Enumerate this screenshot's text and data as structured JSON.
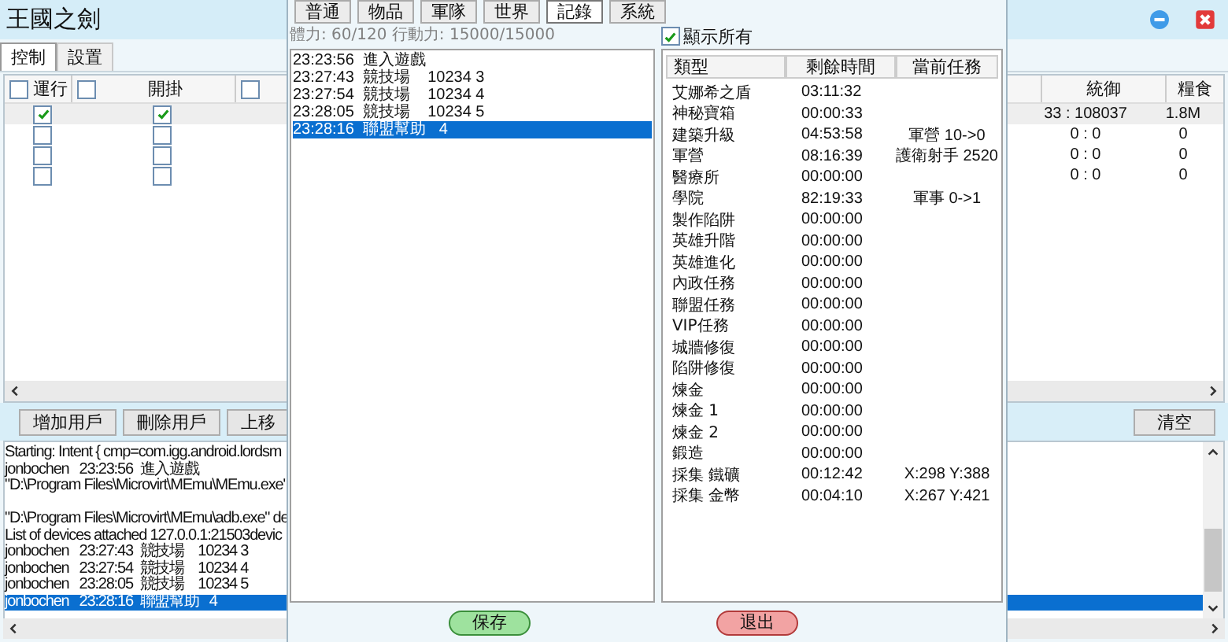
{
  "main_window": {
    "title": "王國之劍",
    "tabs": [
      {
        "label": "控制",
        "selected": true
      },
      {
        "label": "設置",
        "selected": false
      }
    ],
    "accounts_table": {
      "header": {
        "run_checked": false,
        "run_label": "運行",
        "second_checked": false,
        "hack_label": "開掛",
        "third_checked": false,
        "right_columns": [
          "統御",
          "糧食"
        ]
      },
      "rows": [
        {
          "selected": true,
          "run": true,
          "hack": true,
          "leadership": "33 : 108037",
          "food": "1.8M"
        },
        {
          "selected": false,
          "run": false,
          "hack": false,
          "leadership": "0 : 0",
          "food": "0"
        },
        {
          "selected": false,
          "run": false,
          "hack": false,
          "leadership": "0 : 0",
          "food": "0"
        },
        {
          "selected": false,
          "run": false,
          "hack": false,
          "leadership": "0 : 0",
          "food": "0"
        }
      ]
    },
    "buttons": [
      "增加用戶",
      "刪除用戶",
      "上移"
    ],
    "clear_button": "清空",
    "log": [
      {
        "kind": "text",
        "text": "Starting: Intent { cmp=com.igg.android.lordsm",
        "selected": false
      },
      {
        "kind": "text",
        "text": "jonbochen   23:23:56  進入遊戲",
        "selected": false
      },
      {
        "kind": "text",
        "text": "\"D:\\Program Files\\Microvirt\\MEmu\\MEmu.exe\"",
        "selected": false
      },
      {
        "kind": "blank"
      },
      {
        "kind": "text",
        "text": "\"D:\\Program Files\\Microvirt\\MEmu\\adb.exe\" de",
        "selected": false
      },
      {
        "kind": "text",
        "text": "List of devices attached 127.0.0.1:21503devic",
        "selected": false
      },
      {
        "kind": "text",
        "text": "jonbochen   23:27:43  競技場    10234 3",
        "selected": false
      },
      {
        "kind": "text",
        "text": "jonbochen   23:27:54  競技場    10234 4",
        "selected": false
      },
      {
        "kind": "text",
        "text": "jonbochen   23:28:05  競技場    10234 5",
        "selected": false
      },
      {
        "kind": "text",
        "text": "jonbochen   23:28:16  聯盟幫助   4",
        "selected": true
      }
    ]
  },
  "record_dialog": {
    "tabs": [
      {
        "label": "普通",
        "selected": false
      },
      {
        "label": "物品",
        "selected": false
      },
      {
        "label": "軍隊",
        "selected": false
      },
      {
        "label": "世界",
        "selected": false
      },
      {
        "label": "記錄",
        "selected": true
      },
      {
        "label": "系統",
        "selected": false
      }
    ],
    "stats": "體力: 60/120  行動力: 15000/15000",
    "records": [
      {
        "text": "23:23:56  進入遊戲",
        "selected": false
      },
      {
        "text": "23:27:43  競技場    10234 3",
        "selected": false
      },
      {
        "text": "23:27:54  競技場    10234 4",
        "selected": false
      },
      {
        "text": "23:28:05  競技場    10234 5",
        "selected": false
      },
      {
        "text": "23:28:16  聯盟幫助   4",
        "selected": true
      }
    ],
    "show_all": {
      "label": "顯示所有",
      "checked": true
    },
    "timers": {
      "columns": [
        "類型",
        "剩餘時間",
        "當前任務"
      ],
      "rows": [
        {
          "type": "艾娜希之盾",
          "remaining": "03:11:32"
        },
        {
          "type": "神秘寶箱",
          "remaining": "00:00:33"
        },
        {
          "type": "建築升級",
          "remaining": "04:53:58",
          "task": "軍營 10->0"
        },
        {
          "type": "軍營",
          "remaining": "08:16:39",
          "task": "護衛射手 2520"
        },
        {
          "type": "醫療所",
          "remaining": "00:00:00"
        },
        {
          "type": "學院",
          "remaining": "82:19:33",
          "task": "軍事 0->1"
        },
        {
          "type": "製作陷阱",
          "remaining": "00:00:00"
        },
        {
          "type": "英雄升階",
          "remaining": "00:00:00"
        },
        {
          "type": "英雄進化",
          "remaining": "00:00:00"
        },
        {
          "type": "內政任務",
          "remaining": "00:00:00"
        },
        {
          "type": "聯盟任務",
          "remaining": "00:00:00"
        },
        {
          "type": "VIP任務",
          "remaining": "00:00:00"
        },
        {
          "type": "城牆修復",
          "remaining": "00:00:00"
        },
        {
          "type": "陷阱修復",
          "remaining": "00:00:00"
        },
        {
          "type": "煉金",
          "remaining": "00:00:00"
        },
        {
          "type": "煉金 1",
          "remaining": "00:00:00"
        },
        {
          "type": "煉金 2",
          "remaining": "00:00:00"
        },
        {
          "type": "鍛造",
          "remaining": "00:00:00"
        },
        {
          "type": "採集 鐵礦",
          "remaining": "00:12:42",
          "task": "X:298 Y:388"
        },
        {
          "type": "採集 金幣",
          "remaining": "00:04:10",
          "task": "X:267 Y:421"
        }
      ]
    },
    "buttons": [
      {
        "label": "保存",
        "kind": "confirm"
      },
      {
        "label": "退出",
        "kind": "cancel"
      }
    ]
  }
}
